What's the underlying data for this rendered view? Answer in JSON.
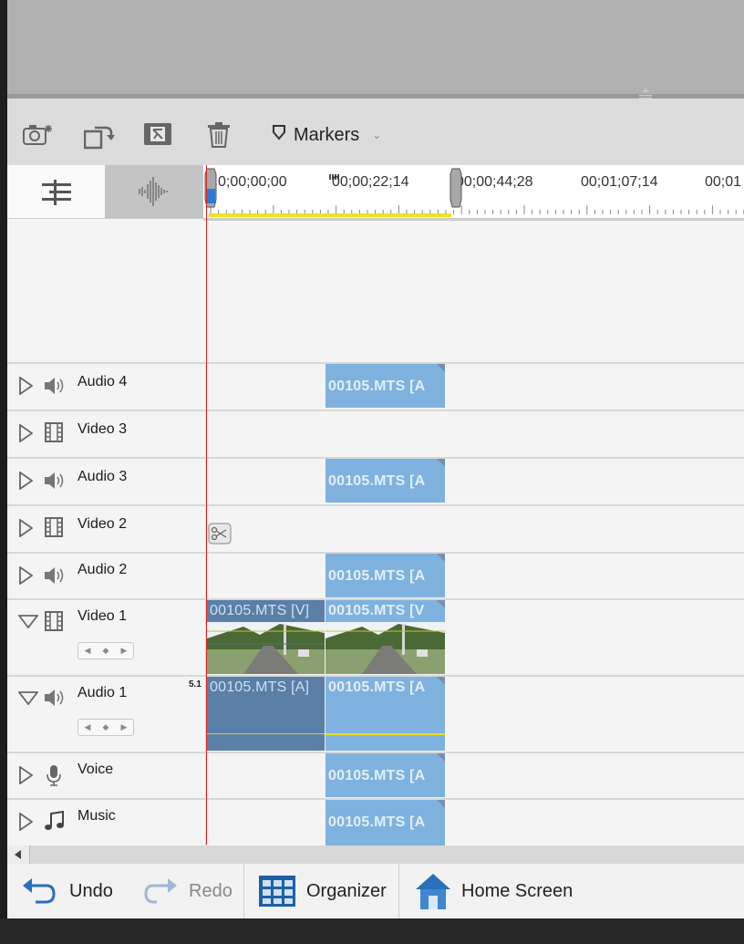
{
  "toolbar": {
    "markers_label": "Markers"
  },
  "ruler": {
    "timecodes": [
      "0;00;00;00",
      "00;00;22;14",
      "00;00;44;28",
      "00;01;07;14",
      "00;01"
    ]
  },
  "tracks": [
    {
      "name": "Audio 4",
      "type": "audio",
      "expanded": false
    },
    {
      "name": "Video 3",
      "type": "video",
      "expanded": false
    },
    {
      "name": "Audio 3",
      "type": "audio",
      "expanded": false
    },
    {
      "name": "Video 2",
      "type": "video",
      "expanded": false
    },
    {
      "name": "Audio 2",
      "type": "audio",
      "expanded": false
    },
    {
      "name": "Video 1",
      "type": "video",
      "expanded": true
    },
    {
      "name": "Audio 1",
      "type": "audio",
      "expanded": true,
      "channel_badge": "5.1"
    },
    {
      "name": "Voice",
      "type": "voice",
      "expanded": false
    },
    {
      "name": "Music",
      "type": "music",
      "expanded": false
    }
  ],
  "clips": {
    "audio4": "00105.MTS [A",
    "audio3": "00105.MTS [A",
    "audio2": "00105.MTS [A",
    "video1_a": "00105.MTS [V]",
    "video1_b": "00105.MTS [V",
    "audio1_a": "00105.MTS [A]",
    "audio1_b": "00105.MTS [A",
    "voice": "00105.MTS [A",
    "music": "00105.MTS [A"
  },
  "bottom_bar": {
    "undo": "Undo",
    "redo": "Redo",
    "organizer": "Organizer",
    "home_screen": "Home Screen"
  },
  "colors": {
    "clip_blue": "#7fb2de",
    "clip_selected": "#5b7fa6",
    "playhead": "#e02020",
    "work_area": "#f0e020"
  }
}
